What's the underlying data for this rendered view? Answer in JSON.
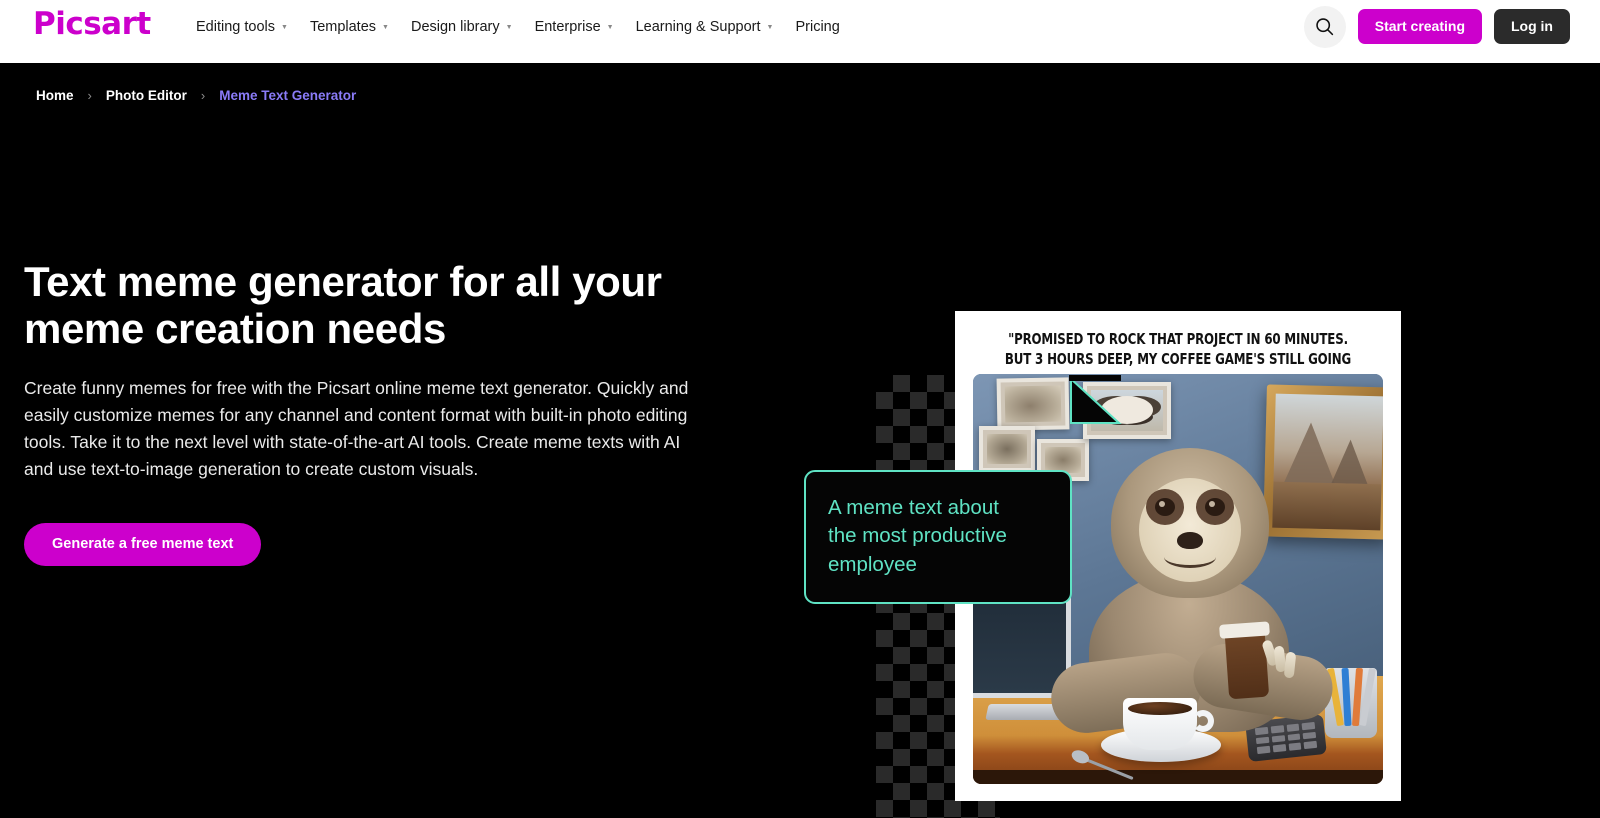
{
  "header": {
    "logo_text": "Picsart",
    "nav": [
      {
        "label": "Editing tools",
        "has_dropdown": true
      },
      {
        "label": "Templates",
        "has_dropdown": true
      },
      {
        "label": "Design library",
        "has_dropdown": true
      },
      {
        "label": "Enterprise",
        "has_dropdown": true
      },
      {
        "label": "Learning & Support",
        "has_dropdown": true
      },
      {
        "label": "Pricing",
        "has_dropdown": false
      }
    ],
    "search_icon": "search-icon",
    "start_creating_label": "Start creating",
    "login_label": "Log in",
    "brand_color": "#cc00cc",
    "background": "#ffffff"
  },
  "breadcrumb": {
    "items": [
      {
        "label": "Home",
        "active": false
      },
      {
        "label": "Photo Editor",
        "active": false
      },
      {
        "label": "Meme Text Generator",
        "active": true
      }
    ],
    "separator": "›",
    "active_color": "#8a7bf7"
  },
  "hero": {
    "title": "Text meme generator for all your meme creation needs",
    "description": "Create funny memes for free with the Picsart online meme text generator. Quickly and easily customize memes for any channel and content format with built-in photo editing tools. Take it to the next level with state-of-the-art AI tools. Create meme texts with AI and use text-to-image generation to create custom visuals.",
    "cta_label": "Generate a free meme text",
    "cta_color": "#cc00cc",
    "background": "#000000"
  },
  "meme_preview": {
    "caption_top": "\"PROMISED TO ROCK THAT PROJECT IN 60 MINUTES.\nBUT 3 HOURS DEEP, MY COFFEE GAME'S STILL GOING STRONG\"",
    "speech_bubble_text": "A meme text about\nthe most productive\nemployee",
    "speech_bubble_color": "#5fe3c4",
    "card_background": "#ffffff",
    "image_alt": "Smiling sloth sitting at an office desk holding a takeaway coffee cup, with a cup of coffee, laptop, calculator and pencil holder on the desk and framed pictures on a blue wall"
  }
}
